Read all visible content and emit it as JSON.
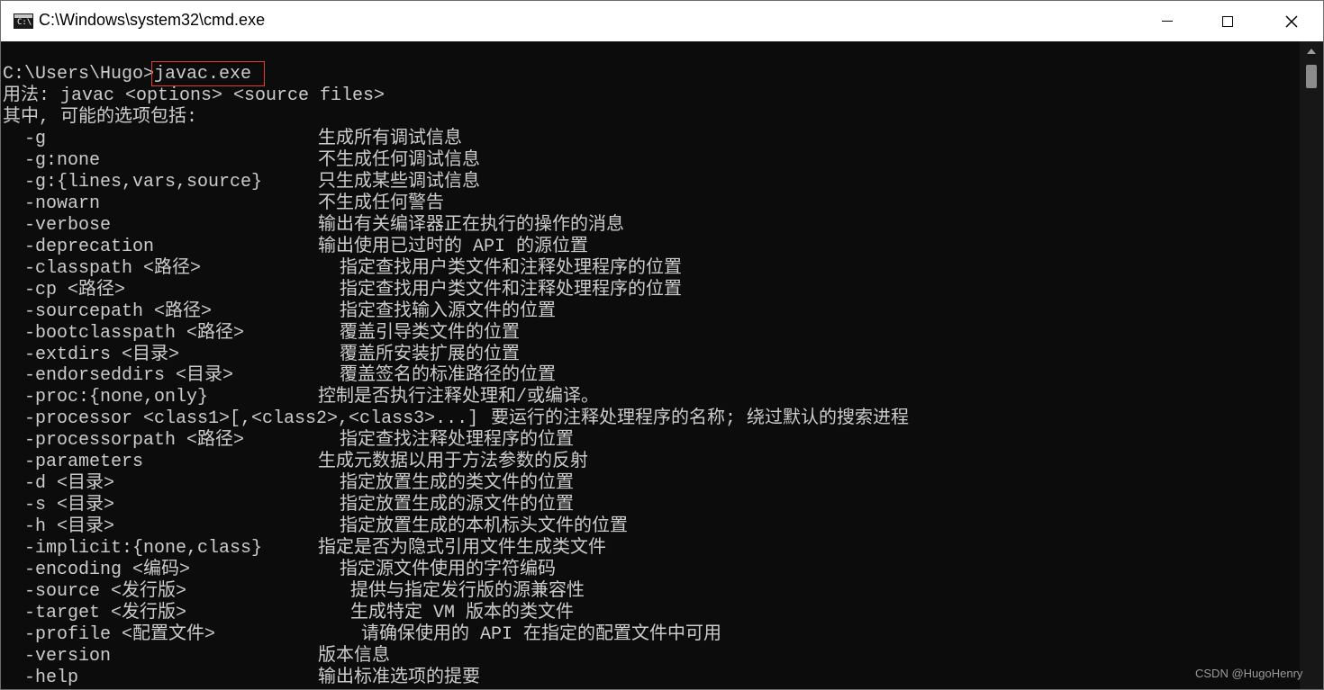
{
  "window": {
    "title": "C:\\Windows\\system32\\cmd.exe",
    "icon": "cmd-icon",
    "icon_prompt": "C:\\",
    "controls": [
      "minimize-icon",
      "maximize-icon",
      "close-icon"
    ],
    "close_glyph": "✕"
  },
  "console": {
    "prompt": "C:\\Users\\Hugo>",
    "command": "javac.exe",
    "usage": "用法: javac <options> <source files>",
    "options_header": "其中, 可能的选项包括:",
    "options": [
      {
        "option": "-g",
        "description": "生成所有调试信息"
      },
      {
        "option": "-g:none",
        "description": "不生成任何调试信息"
      },
      {
        "option": "-g:{lines,vars,source}",
        "description": "只生成某些调试信息"
      },
      {
        "option": "-nowarn",
        "description": "不生成任何警告"
      },
      {
        "option": "-verbose",
        "description": "输出有关编译器正在执行的操作的消息"
      },
      {
        "option": "-deprecation",
        "description": "输出使用已过时的 API 的源位置"
      },
      {
        "option": "-classpath <路径>",
        "description": "指定查找用户类文件和注释处理程序的位置"
      },
      {
        "option": "-cp <路径>",
        "description": "指定查找用户类文件和注释处理程序的位置"
      },
      {
        "option": "-sourcepath <路径>",
        "description": "指定查找输入源文件的位置"
      },
      {
        "option": "-bootclasspath <路径>",
        "description": "覆盖引导类文件的位置"
      },
      {
        "option": "-extdirs <目录>",
        "description": "覆盖所安装扩展的位置"
      },
      {
        "option": "-endorseddirs <目录>",
        "description": "覆盖签名的标准路径的位置"
      },
      {
        "option": "-proc:{none,only}",
        "description": "控制是否执行注释处理和/或编译。"
      },
      {
        "option": "-processor <class1>[,<class2>,<class3>...]",
        "description": "要运行的注释处理程序的名称; 绕过默认的搜索进程"
      },
      {
        "option": "-processorpath <路径>",
        "description": "指定查找注释处理程序的位置"
      },
      {
        "option": "-parameters",
        "description": "生成元数据以用于方法参数的反射"
      },
      {
        "option": "-d <目录>",
        "description": "指定放置生成的类文件的位置"
      },
      {
        "option": "-s <目录>",
        "description": "指定放置生成的源文件的位置"
      },
      {
        "option": "-h <目录>",
        "description": "指定放置生成的本机标头文件的位置"
      },
      {
        "option": "-implicit:{none,class}",
        "description": "指定是否为隐式引用文件生成类文件"
      },
      {
        "option": "-encoding <编码>",
        "description": "指定源文件使用的字符编码"
      },
      {
        "option": "-source <发行版>",
        "description": "提供与指定发行版的源兼容性"
      },
      {
        "option": "-target <发行版>",
        "description": "生成特定 VM 版本的类文件"
      },
      {
        "option": "-profile <配置文件>",
        "description": "请确保使用的 API 在指定的配置文件中可用"
      },
      {
        "option": "-version",
        "description": "版本信息"
      },
      {
        "option": "-help",
        "description": "输出标准选项的提要"
      }
    ]
  },
  "watermark": "CSDN @HugoHenry",
  "colors": {
    "console_bg": "#0c0c0c",
    "console_text": "#cccccc",
    "highlight_border": "#e03c31",
    "titlebar_bg": "#ffffff"
  }
}
